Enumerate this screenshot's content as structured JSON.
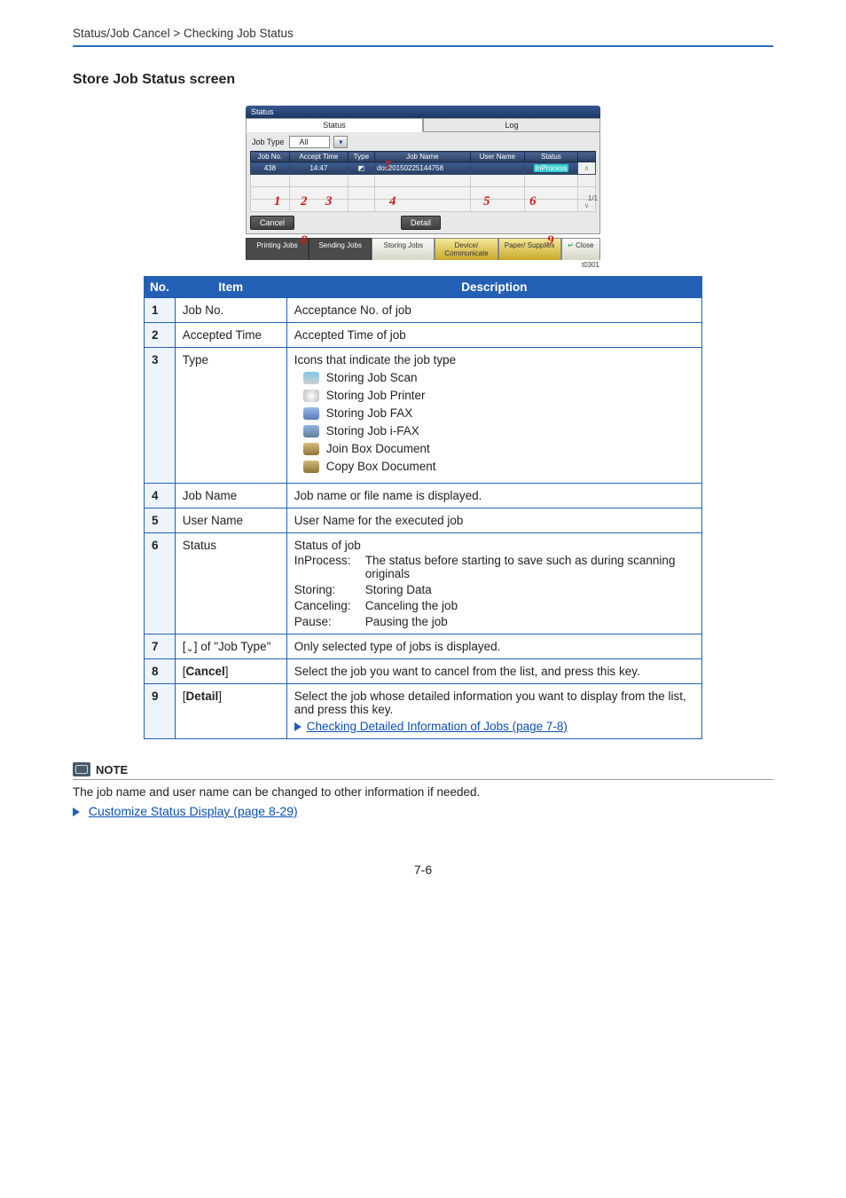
{
  "header": {
    "breadcrumb": "Status/Job Cancel > Checking Job Status"
  },
  "section_title": "Store Job Status screen",
  "ui": {
    "title": "Status",
    "tab_status": "Status",
    "tab_log": "Log",
    "jobtype_label": "Job Type",
    "jobtype_value": "All",
    "cols": {
      "no": "Job No.",
      "time": "Accept Time",
      "type": "Type",
      "name": "Job Name",
      "user": "User Name",
      "status": "Status"
    },
    "row": {
      "no": "438",
      "time": "14:47",
      "name": "doc20150225144758",
      "user": "",
      "status": "InProcess"
    },
    "page_counter": "1/1",
    "btn_cancel": "Cancel",
    "btn_detail": "Detail",
    "tabs": {
      "printing": "Printing Jobs",
      "sending": "Sending Jobs",
      "storing": "Storing Jobs",
      "device": "Device/\nCommunicate",
      "paper": "Paper/\nSupplies",
      "close": "Close"
    },
    "foot_code": "t0301",
    "callouts": {
      "1": "1",
      "2": "2",
      "3": "3",
      "4": "4",
      "5": "5",
      "6": "6",
      "7": "7",
      "8": "8",
      "9": "9"
    }
  },
  "desc": {
    "head": {
      "no": "No.",
      "item": "Item",
      "desc": "Description"
    },
    "rows": {
      "1": {
        "no": "1",
        "item": "Job No.",
        "desc": "Acceptance No. of job"
      },
      "2": {
        "no": "2",
        "item": "Accepted Time",
        "desc": "Accepted Time of job"
      },
      "3": {
        "no": "3",
        "item": "Type",
        "lead": "Icons that indicate the job type",
        "icons": {
          "scan": "Storing Job Scan",
          "print": "Storing Job Printer",
          "fax": "Storing Job FAX",
          "ifax": "Storing Job i-FAX",
          "join": "Join Box Document",
          "copy": "Copy Box Document"
        }
      },
      "4": {
        "no": "4",
        "item": "Job Name",
        "desc": "Job name or file name is displayed."
      },
      "5": {
        "no": "5",
        "item": "User Name",
        "desc": "User Name for the executed job"
      },
      "6": {
        "no": "6",
        "item": "Status",
        "lead": "Status of job",
        "st": {
          "inprocess_k": "InProcess:",
          "inprocess_v": "The status before starting to save such as during scanning originals",
          "storing_k": "Storing:",
          "storing_v": "Storing Data",
          "cancel_k": "Canceling:",
          "cancel_v": "Canceling the job",
          "pause_k": "Pause:",
          "pause_v": "Pausing the job"
        }
      },
      "7": {
        "no": "7",
        "item_prefix": "[",
        "item_suffix": "] of \"Job Type\"",
        "desc": "Only selected type of jobs is displayed."
      },
      "8": {
        "no": "8",
        "item": "[Cancel]",
        "desc": "Select the job you want to cancel from the list, and press this key."
      },
      "9": {
        "no": "9",
        "item": "[Detail]",
        "desc": "Select the job whose detailed information you want to display from the list, and press this key.",
        "link": "Checking Detailed Information of Jobs (page 7-8)"
      }
    }
  },
  "note": {
    "label": "NOTE",
    "body": "The job name and user name can be changed to other information if needed.",
    "link": "Customize Status Display (page 8-29)"
  },
  "page_num": "7-6"
}
